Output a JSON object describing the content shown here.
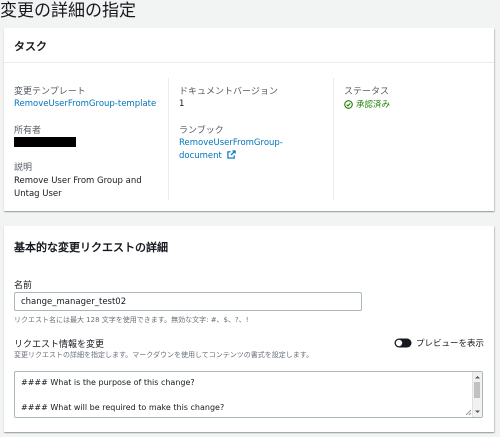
{
  "page": {
    "title": "変更の詳細の指定"
  },
  "task_card": {
    "title": "タスク",
    "change_template": {
      "label": "変更テンプレート",
      "value": "RemoveUserFromGroup-template"
    },
    "owner": {
      "label": "所有者"
    },
    "description": {
      "label": "説明",
      "value_line1": "Remove User From Group and",
      "value_line2": "Untag User"
    },
    "document_version": {
      "label": "ドキュメントバージョン",
      "value": "1"
    },
    "runbook": {
      "label": "ランブック",
      "value_line1": "RemoveUserFromGroup-",
      "value_line2": "document"
    },
    "status": {
      "label": "ステータス",
      "value": "承認済み"
    }
  },
  "details_card": {
    "title": "基本的な変更リクエストの詳細",
    "name": {
      "label": "名前",
      "value": "change_manager_test02",
      "hint": "リクエスト名には最大 128 文字を使用できます。無効な文字: #、$、?、!"
    },
    "request_info": {
      "label": "リクエスト情報を変更",
      "hint": "変更リクエストの詳細を指定します。マークダウンを使用してコンテンツの書式を設定します。",
      "preview_label": "プレビューを表示",
      "line1": "#### What is the purpose of this change?",
      "line2": "#### What will be required to make this change?"
    }
  },
  "colors": {
    "link": "#0073bb",
    "success": "#1d8102",
    "text": "#16191f",
    "muted": "#545b64"
  }
}
